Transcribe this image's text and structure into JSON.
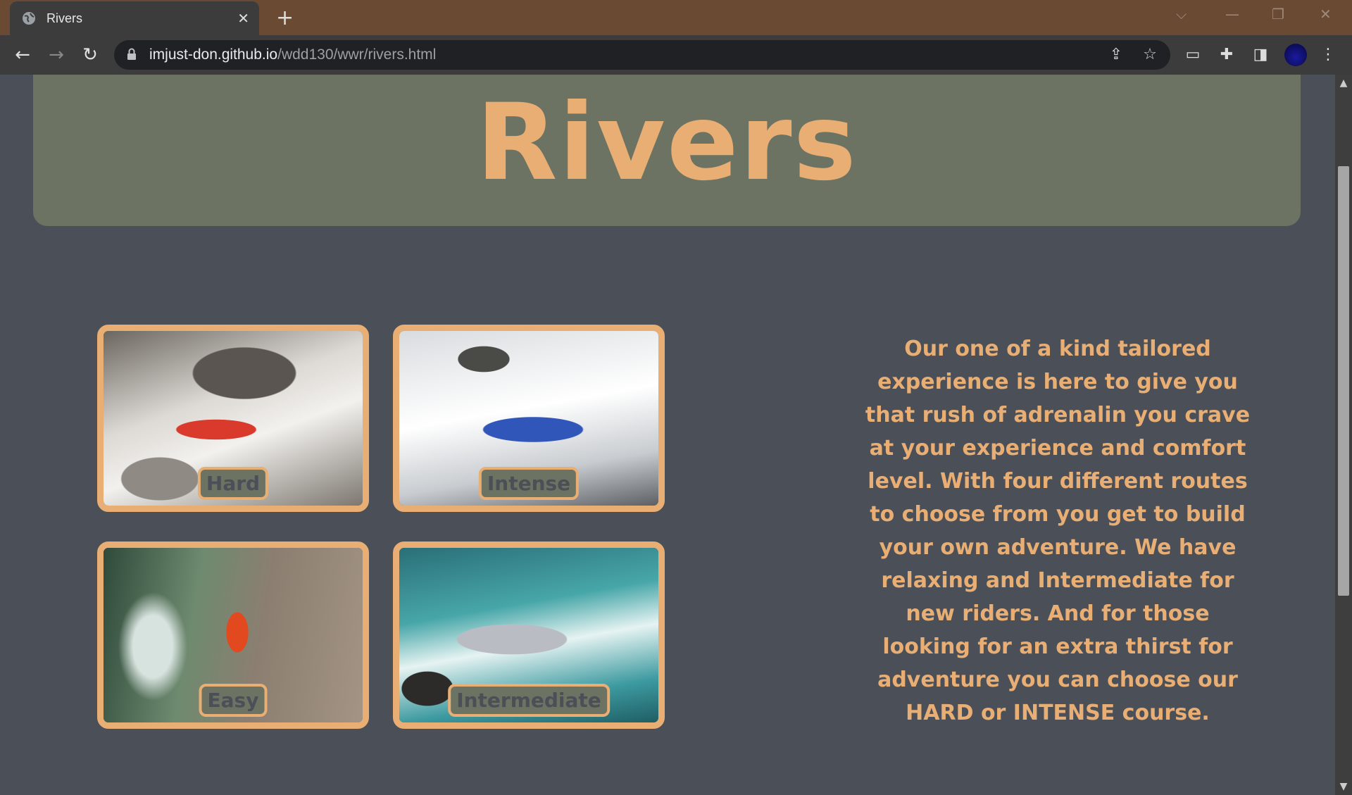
{
  "browser": {
    "tab_title": "Rivers",
    "url_host": "imjust-don.github.io",
    "url_path": "/wdd130/wwr/rivers.html"
  },
  "page": {
    "title": "Rivers",
    "cards": [
      {
        "label": "Hard"
      },
      {
        "label": "Intense"
      },
      {
        "label": "Easy"
      },
      {
        "label": "Intermediate"
      }
    ],
    "description": "Our one of a kind tailored experience is here to give you that rush of adrenalin you crave at your experience and comfort level. With four different routes to choose from you get to build your own adventure. We have relaxing and Intermediate for new riders. And for those looking for an extra thirst for adventure you can choose our HARD or INTENSE course."
  },
  "colors": {
    "accent": "#e8ae74",
    "page_bg": "#4b5058",
    "hero_bg": "#6c7363"
  },
  "icons": [
    "globe-icon",
    "close-icon",
    "plus-icon",
    "back-icon",
    "forward-icon",
    "reload-icon",
    "lock-icon",
    "share-icon",
    "star-icon",
    "cast-icon",
    "puzzle-icon",
    "sidepanel-icon",
    "menu-icon"
  ]
}
